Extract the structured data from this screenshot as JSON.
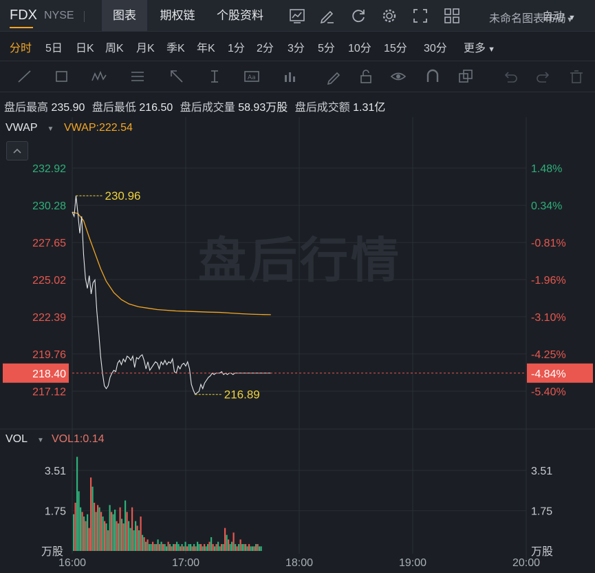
{
  "header": {
    "symbol": "FDX",
    "exchange": "NYSE",
    "tabs": [
      "图表",
      "期权链",
      "个股资料"
    ],
    "layout_label": "未命名图表布局",
    "icons": [
      "indicator-icon",
      "draw-icon",
      "refresh-icon",
      "settings-icon",
      "fullscreen-icon",
      "layout-grid-icon"
    ]
  },
  "periods": {
    "items": [
      "分时",
      "5日",
      "日K",
      "周K",
      "月K",
      "季K",
      "年K",
      "1分",
      "2分",
      "3分",
      "5分",
      "10分",
      "15分",
      "30分",
      "更多"
    ],
    "active": "分时",
    "auto_label": "自动"
  },
  "stats": {
    "high_label": "盘后最高",
    "high": "235.90",
    "low_label": "盘后最低",
    "low": "216.50",
    "volume_label": "盘后成交量",
    "volume": "58.93万股",
    "amount_label": "盘后成交额",
    "amount": "1.31亿"
  },
  "colors": {
    "up": "#2fb07a",
    "down": "#e9574f",
    "vwap": "#f5a623",
    "accent": "#f5a623",
    "price_line": "#e6e8eb"
  },
  "chart_data": {
    "type": "line",
    "watermark": "盘后行情",
    "main": {
      "indicator_name": "VWAP",
      "indicator_value": "VWAP:222.54",
      "y_ticks": [
        "232.92",
        "230.28",
        "227.65",
        "225.02",
        "222.39",
        "219.76",
        "217.12"
      ],
      "pct_ticks": [
        "1.48%",
        "0.34%",
        "-0.81%",
        "-1.96%",
        "-3.10%",
        "-4.25%",
        "-5.40%"
      ],
      "ylim": [
        215.5,
        234.9
      ],
      "current_price": "218.40",
      "current_pct": "-4.84%",
      "high_marker": "230.96",
      "low_marker": "216.89",
      "price": {
        "t": [
          0,
          1,
          2,
          3,
          4,
          5,
          6,
          7,
          8,
          9,
          10,
          11,
          12,
          13,
          14,
          15,
          16,
          17,
          18,
          19,
          20,
          21,
          22,
          23,
          24,
          25,
          26,
          27,
          28,
          29,
          30,
          31,
          32,
          33,
          34,
          35,
          36,
          37,
          38,
          39,
          40,
          41,
          42,
          43,
          44,
          45,
          46,
          47,
          48,
          49,
          50,
          51,
          52,
          53,
          54,
          55,
          56,
          57,
          58,
          59,
          60,
          61,
          62,
          63,
          64,
          65,
          66,
          67,
          68,
          69,
          70,
          71,
          72,
          73,
          74,
          75,
          76,
          77,
          78,
          79,
          80,
          81,
          82,
          83,
          84,
          85,
          86,
          87,
          88,
          89,
          90,
          91,
          92,
          93,
          94,
          95,
          96,
          97,
          98,
          99,
          100,
          102,
          105
        ],
        "v": [
          229.8,
          229.5,
          230.96,
          229.7,
          228.3,
          229.5,
          226.8,
          225.1,
          224.4,
          225.3,
          224.0,
          224.8,
          225.0,
          222.8,
          221.3,
          219.6,
          218.4,
          217.5,
          217.3,
          217.5,
          218.1,
          218.4,
          218.6,
          218.5,
          219.1,
          219.3,
          219.0,
          219.4,
          219.2,
          219.6,
          219.5,
          219.3,
          219.6,
          218.8,
          219.5,
          219.4,
          219.6,
          219.7,
          219.3,
          218.7,
          219.2,
          218.6,
          218.8,
          219.0,
          219.2,
          219.1,
          218.7,
          219.2,
          219.0,
          219.3,
          219.0,
          219.2,
          219.1,
          219.4,
          218.5,
          218.4,
          218.9,
          218.7,
          219.0,
          219.1,
          218.9,
          219.2,
          218.7,
          217.6,
          217.2,
          216.89,
          217.0,
          217.1,
          217.6,
          217.3,
          217.7,
          217.9,
          218.1,
          218.2,
          218.4,
          218.3,
          218.4,
          218.4,
          218.4,
          218.5,
          218.3,
          218.4,
          218.3,
          218.4,
          218.4,
          218.3,
          218.4,
          218.4,
          218.4,
          218.4,
          218.4,
          218.4,
          218.4,
          218.4,
          218.4,
          218.4,
          218.4,
          218.4,
          218.4,
          218.4,
          218.4,
          218.4,
          218.4
        ]
      },
      "vwap": {
        "t": [
          0,
          3,
          6,
          9,
          12,
          15,
          18,
          22,
          26,
          30,
          35,
          40,
          45,
          50,
          55,
          60,
          66,
          72,
          78,
          84,
          90,
          95,
          100,
          105
        ],
        "v": [
          229.8,
          229.7,
          229.2,
          228.0,
          226.9,
          225.8,
          224.9,
          224.1,
          223.6,
          223.3,
          223.1,
          223.0,
          222.9,
          222.85,
          222.8,
          222.78,
          222.75,
          222.72,
          222.7,
          222.65,
          222.6,
          222.57,
          222.55,
          222.54
        ]
      }
    },
    "volume": {
      "indicator_name": "VOL",
      "indicator_value": "VOL1:0.14",
      "y_ticks": [
        "3.51",
        "1.75"
      ],
      "unit": "万股",
      "ylim": [
        0,
        4.2
      ],
      "bars": [
        1.6,
        2.1,
        4.1,
        2.6,
        1.9,
        1.7,
        1.5,
        1.3,
        1.6,
        1.0,
        3.2,
        2.8,
        2.1,
        1.7,
        2.0,
        1.9,
        1.7,
        1.5,
        1.3,
        1.2,
        0.9,
        2.0,
        1.7,
        1.6,
        1.8,
        1.3,
        1.2,
        1.9,
        1.4,
        1.2,
        2.2,
        1.7,
        1.3,
        1.0,
        1.9,
        0.9,
        1.3,
        1.1,
        0.9,
        1.5,
        0.7,
        0.6,
        0.4,
        0.5,
        0.3,
        0.3,
        0.4,
        0.3,
        0.3,
        0.5,
        0.3,
        0.4,
        0.3,
        0.3,
        0.2,
        0.4,
        0.3,
        0.2,
        0.3,
        0.3,
        0.4,
        0.3,
        0.2,
        0.3,
        0.2,
        0.4,
        0.2,
        0.3,
        0.3,
        0.2,
        0.3,
        0.2,
        0.4,
        0.3,
        0.3,
        0.2,
        0.3,
        0.2,
        0.3,
        0.4,
        0.6,
        0.3,
        0.2,
        0.3,
        0.4,
        0.2,
        0.3,
        0.3,
        1.0,
        0.7,
        0.5,
        0.3,
        0.4,
        0.8,
        0.3,
        0.2,
        0.3,
        0.5,
        0.3,
        0.3,
        0.3,
        0.2,
        0.3,
        0.2,
        0.2,
        0.2,
        0.3,
        0.3,
        0.2,
        0.2
      ],
      "up": [
        1,
        0,
        1,
        1,
        1,
        0,
        1,
        0,
        1,
        0,
        0,
        1,
        0,
        1,
        0,
        1,
        0,
        1,
        0,
        1,
        0,
        1,
        0,
        1,
        1,
        0,
        1,
        0,
        1,
        0,
        1,
        0,
        1,
        1,
        0,
        1,
        1,
        0,
        1,
        0,
        1,
        0,
        1,
        0,
        1,
        1,
        0,
        1,
        0,
        1,
        0,
        1,
        0,
        1,
        1,
        0,
        1,
        0,
        1,
        0,
        1,
        1,
        0,
        1,
        0,
        1,
        0,
        1,
        1,
        0,
        1,
        0,
        1,
        1,
        0,
        1,
        0,
        1,
        1,
        0,
        1,
        0,
        1,
        0,
        1,
        1,
        0,
        1,
        0,
        1,
        0,
        1,
        1,
        0,
        1,
        0,
        1,
        0,
        1,
        1,
        0,
        1,
        0,
        1,
        1,
        0,
        1,
        0,
        1,
        1
      ]
    },
    "x_ticks": [
      "16:00",
      "17:00",
      "18:00",
      "19:00",
      "20:00"
    ],
    "x_range_minutes": [
      0,
      240
    ]
  }
}
